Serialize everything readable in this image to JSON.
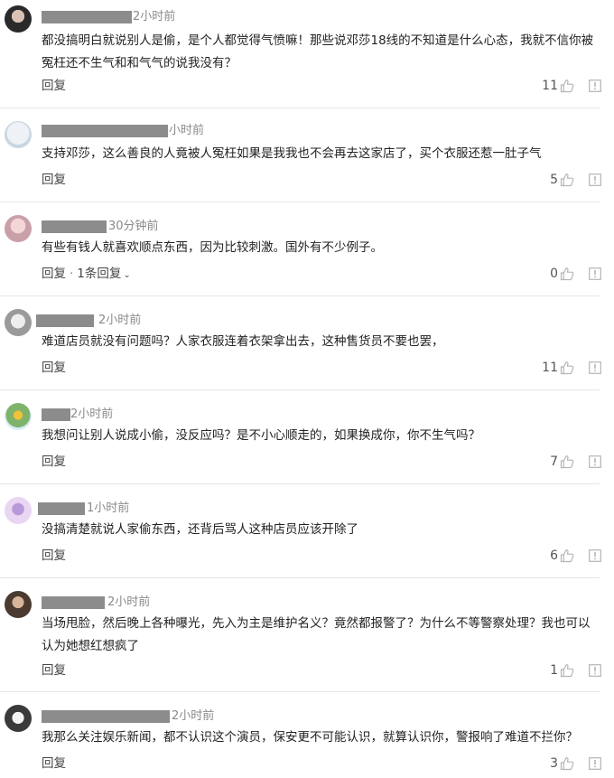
{
  "comments": [
    {
      "time": "2小时前",
      "text": "都没搞明白就说别人是偷，是个人都觉得气愤嘛！那些说邓莎18线的不知道是什么心态，我就不信你被冤枉还不生气和和气气的说我没有？",
      "reply_label": "回复",
      "likes": "11"
    },
    {
      "time": "小时前",
      "text": "支持邓莎，这么善良的人竟被人冤枉如果是我我也不会再去这家店了，买个衣服还惹一肚子气",
      "reply_label": "回复",
      "likes": "5"
    },
    {
      "time": "30分钟前",
      "text": "有些有钱人就喜欢顺点东西，因为比较刺激。国外有不少例子。",
      "reply_label": "回复",
      "reply_sep": "·",
      "replies_label": "1条回复",
      "likes": "0"
    },
    {
      "time": "2小时前",
      "text": "难道店员就没有问题吗？人家衣服连着衣架拿出去，这种售货员不要也罢，",
      "reply_label": "回复",
      "likes": "11"
    },
    {
      "time": "2小时前",
      "text": "我想问让别人说成小偷，没反应吗？是不小心顺走的，如果换成你，你不生气吗？",
      "reply_label": "回复",
      "likes": "7"
    },
    {
      "time": "1小时前",
      "text": "没搞清楚就说人家偷东西，还背后骂人这种店员应该开除了",
      "reply_label": "回复",
      "likes": "6"
    },
    {
      "time": "2小时前",
      "text": "当场甩脸，然后晚上各种曝光，先入为主是维护名义？竟然都报警了？为什么不等警察处理？我也可以认为她想红想疯了",
      "reply_label": "回复",
      "likes": "1"
    },
    {
      "time": "2小时前",
      "text": "我那么关注娱乐新闻，都不认识这个演员，保安更不可能认识，就算认识你，警报响了难道不拦你？",
      "reply_label": "回复",
      "likes": "3"
    }
  ],
  "colors": {
    "name_redaction": "#8c8c8c",
    "time": "#8a8a8a",
    "divider": "#e6e6e6",
    "icon": "#b5b5b5"
  },
  "icons": {
    "like": "thumbs-up-icon",
    "report": "report-icon",
    "expand": "chevron-down-icon"
  }
}
